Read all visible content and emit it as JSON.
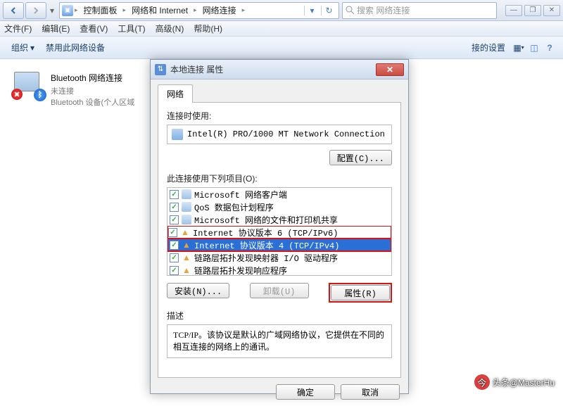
{
  "window": {
    "breadcrumbs": [
      "控制面板",
      "网络和 Internet",
      "网络连接"
    ],
    "search_placeholder": "搜索 网络连接",
    "buttons": {
      "min": "—",
      "max": "❐",
      "close": "✕"
    }
  },
  "menu": {
    "file": "文件(F)",
    "edit": "编辑(E)",
    "view": "查看(V)",
    "tools": "工具(T)",
    "advanced": "高级(N)",
    "help": "帮助(H)"
  },
  "toolbar": {
    "organize": "组织",
    "disable": "禁用此网络设备",
    "diagnose": "接的设置"
  },
  "bluetooth": {
    "name": "Bluetooth 网络连接",
    "status": "未连接",
    "device": "Bluetooth 设备(个人区域"
  },
  "dialog": {
    "title": "本地连接 属性",
    "tab": "网络",
    "connect_using_label": "连接时使用:",
    "adapter": "Intel(R) PRO/1000 MT Network Connection",
    "configure_btn": "配置(C)...",
    "items_label": "此连接使用下列项目(O):",
    "items": [
      {
        "label": "Microsoft 网络客户端",
        "icon": "svc",
        "checked": true
      },
      {
        "label": "QoS 数据包计划程序",
        "icon": "svc",
        "checked": true
      },
      {
        "label": "Microsoft 网络的文件和打印机共享",
        "icon": "svc",
        "checked": true
      },
      {
        "label": "Internet 协议版本 6 (TCP/IPv6)",
        "icon": "proto",
        "checked": true,
        "box": "ipv6"
      },
      {
        "label": "Internet 协议版本 4 (TCP/IPv4)",
        "icon": "proto",
        "checked": true,
        "selected": true,
        "box": "ipv4"
      },
      {
        "label": "链路层拓扑发现映射器 I/O 驱动程序",
        "icon": "proto",
        "checked": true
      },
      {
        "label": "链路层拓扑发现响应程序",
        "icon": "proto",
        "checked": true
      }
    ],
    "install_btn": "安装(N)...",
    "uninstall_btn": "卸载(U)",
    "properties_btn": "属性(R)",
    "desc_label": "描述",
    "desc_text": "TCP/IP。该协议是默认的广域网络协议，它提供在不同的相互连接的网络上的通讯。",
    "ok": "确定",
    "cancel": "取消"
  },
  "watermark": "头条@MasterHu"
}
